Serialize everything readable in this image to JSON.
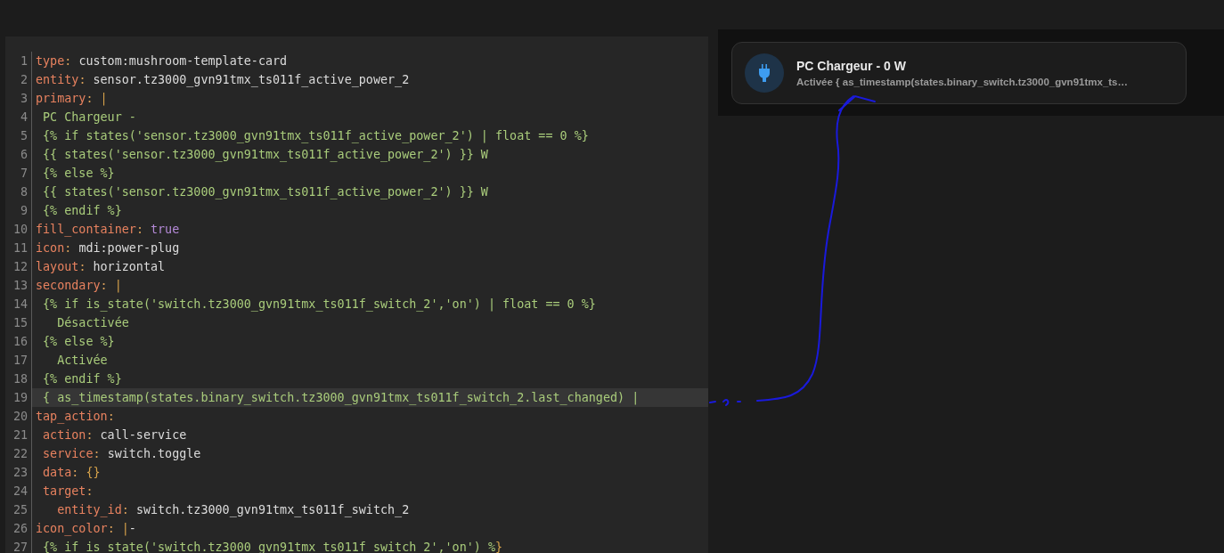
{
  "editor": {
    "lines": [
      {
        "number": "1",
        "active": false,
        "segments": [
          {
            "kind": "key",
            "text": "type"
          },
          {
            "kind": "punct",
            "text": ": "
          },
          {
            "kind": "plain",
            "text": "custom:mushroom-template-card"
          }
        ]
      },
      {
        "number": "2",
        "active": false,
        "segments": [
          {
            "kind": "key",
            "text": "entity"
          },
          {
            "kind": "punct",
            "text": ": "
          },
          {
            "kind": "plain",
            "text": "sensor.tz3000_gvn91tmx_ts011f_active_power_2"
          }
        ]
      },
      {
        "number": "3",
        "active": false,
        "segments": [
          {
            "kind": "key",
            "text": "primary"
          },
          {
            "kind": "punct",
            "text": ": "
          },
          {
            "kind": "pipe",
            "text": "|"
          }
        ]
      },
      {
        "number": "4",
        "active": false,
        "segments": [
          {
            "kind": "template",
            "text": " PC Chargeur -"
          }
        ]
      },
      {
        "number": "5",
        "active": false,
        "segments": [
          {
            "kind": "template",
            "text": " {% if states('sensor.tz3000_gvn91tmx_ts011f_active_power_2') | float == 0 %}"
          }
        ]
      },
      {
        "number": "6",
        "active": false,
        "segments": [
          {
            "kind": "template",
            "text": " {{ states('sensor.tz3000_gvn91tmx_ts011f_active_power_2') }} W"
          }
        ]
      },
      {
        "number": "7",
        "active": false,
        "segments": [
          {
            "kind": "template",
            "text": " {% else %}"
          }
        ]
      },
      {
        "number": "8",
        "active": false,
        "segments": [
          {
            "kind": "template",
            "text": " {{ states('sensor.tz3000_gvn91tmx_ts011f_active_power_2') }} W"
          }
        ]
      },
      {
        "number": "9",
        "active": false,
        "segments": [
          {
            "kind": "template",
            "text": " {% endif %}"
          }
        ]
      },
      {
        "number": "10",
        "active": false,
        "segments": [
          {
            "kind": "key",
            "text": "fill_container"
          },
          {
            "kind": "punct",
            "text": ": "
          },
          {
            "kind": "bool",
            "text": "true"
          }
        ]
      },
      {
        "number": "11",
        "active": false,
        "segments": [
          {
            "kind": "key",
            "text": "icon"
          },
          {
            "kind": "punct",
            "text": ": "
          },
          {
            "kind": "plain",
            "text": "mdi:power-plug"
          }
        ]
      },
      {
        "number": "12",
        "active": false,
        "segments": [
          {
            "kind": "key",
            "text": "layout"
          },
          {
            "kind": "punct",
            "text": ": "
          },
          {
            "kind": "plain",
            "text": "horizontal"
          }
        ]
      },
      {
        "number": "13",
        "active": false,
        "segments": [
          {
            "kind": "key",
            "text": "secondary"
          },
          {
            "kind": "punct",
            "text": ": "
          },
          {
            "kind": "pipe",
            "text": "|"
          }
        ]
      },
      {
        "number": "14",
        "active": false,
        "segments": [
          {
            "kind": "template",
            "text": " {% if is_state('switch.tz3000_gvn91tmx_ts011f_switch_2','on') | float == 0 %}"
          }
        ]
      },
      {
        "number": "15",
        "active": false,
        "segments": [
          {
            "kind": "template",
            "text": "   Désactivée"
          }
        ]
      },
      {
        "number": "16",
        "active": false,
        "segments": [
          {
            "kind": "template",
            "text": " {% else %}"
          }
        ]
      },
      {
        "number": "17",
        "active": false,
        "segments": [
          {
            "kind": "template",
            "text": "   Activée"
          }
        ]
      },
      {
        "number": "18",
        "active": false,
        "segments": [
          {
            "kind": "template",
            "text": " {% endif %}"
          }
        ]
      },
      {
        "number": "19",
        "active": true,
        "segments": [
          {
            "kind": "template",
            "text": " { as_timestamp(states.binary_switch.tz3000_gvn91tmx_ts011f_switch_2.last_changed) |"
          }
        ]
      },
      {
        "number": "20",
        "active": false,
        "segments": [
          {
            "kind": "key",
            "text": "tap_action"
          },
          {
            "kind": "punct",
            "text": ":"
          }
        ]
      },
      {
        "number": "21",
        "active": false,
        "segments": [
          {
            "kind": "key",
            "text": " action"
          },
          {
            "kind": "punct",
            "text": ": "
          },
          {
            "kind": "plain",
            "text": "call-service"
          }
        ]
      },
      {
        "number": "22",
        "active": false,
        "segments": [
          {
            "kind": "key",
            "text": " service"
          },
          {
            "kind": "punct",
            "text": ": "
          },
          {
            "kind": "plain",
            "text": "switch.toggle"
          }
        ]
      },
      {
        "number": "23",
        "active": false,
        "segments": [
          {
            "kind": "key",
            "text": " data"
          },
          {
            "kind": "punct",
            "text": ": "
          },
          {
            "kind": "pipe",
            "text": "{}"
          }
        ]
      },
      {
        "number": "24",
        "active": false,
        "segments": [
          {
            "kind": "key",
            "text": " target"
          },
          {
            "kind": "punct",
            "text": ":"
          }
        ]
      },
      {
        "number": "25",
        "active": false,
        "segments": [
          {
            "kind": "key",
            "text": "   entity_id"
          },
          {
            "kind": "punct",
            "text": ": "
          },
          {
            "kind": "plain",
            "text": "switch.tz3000_gvn91tmx_ts011f_switch_2"
          }
        ]
      },
      {
        "number": "26",
        "active": false,
        "segments": [
          {
            "kind": "key",
            "text": "icon_color"
          },
          {
            "kind": "punct",
            "text": ": "
          },
          {
            "kind": "pipe",
            "text": "|"
          },
          {
            "kind": "plain",
            "text": "-"
          }
        ]
      },
      {
        "number": "27",
        "active": false,
        "segments": [
          {
            "kind": "template",
            "text": " {% if is_state('switch.tz3000_gvn91tmx_ts011f_switch_2','on') %"
          },
          {
            "kind": "pipe",
            "text": "}"
          }
        ]
      }
    ]
  },
  "preview": {
    "card": {
      "primary": "PC Chargeur - 0 W",
      "secondary": "Activée { as_timestamp(states.binary_switch.tz3000_gvn91tmx_ts…"
    }
  }
}
